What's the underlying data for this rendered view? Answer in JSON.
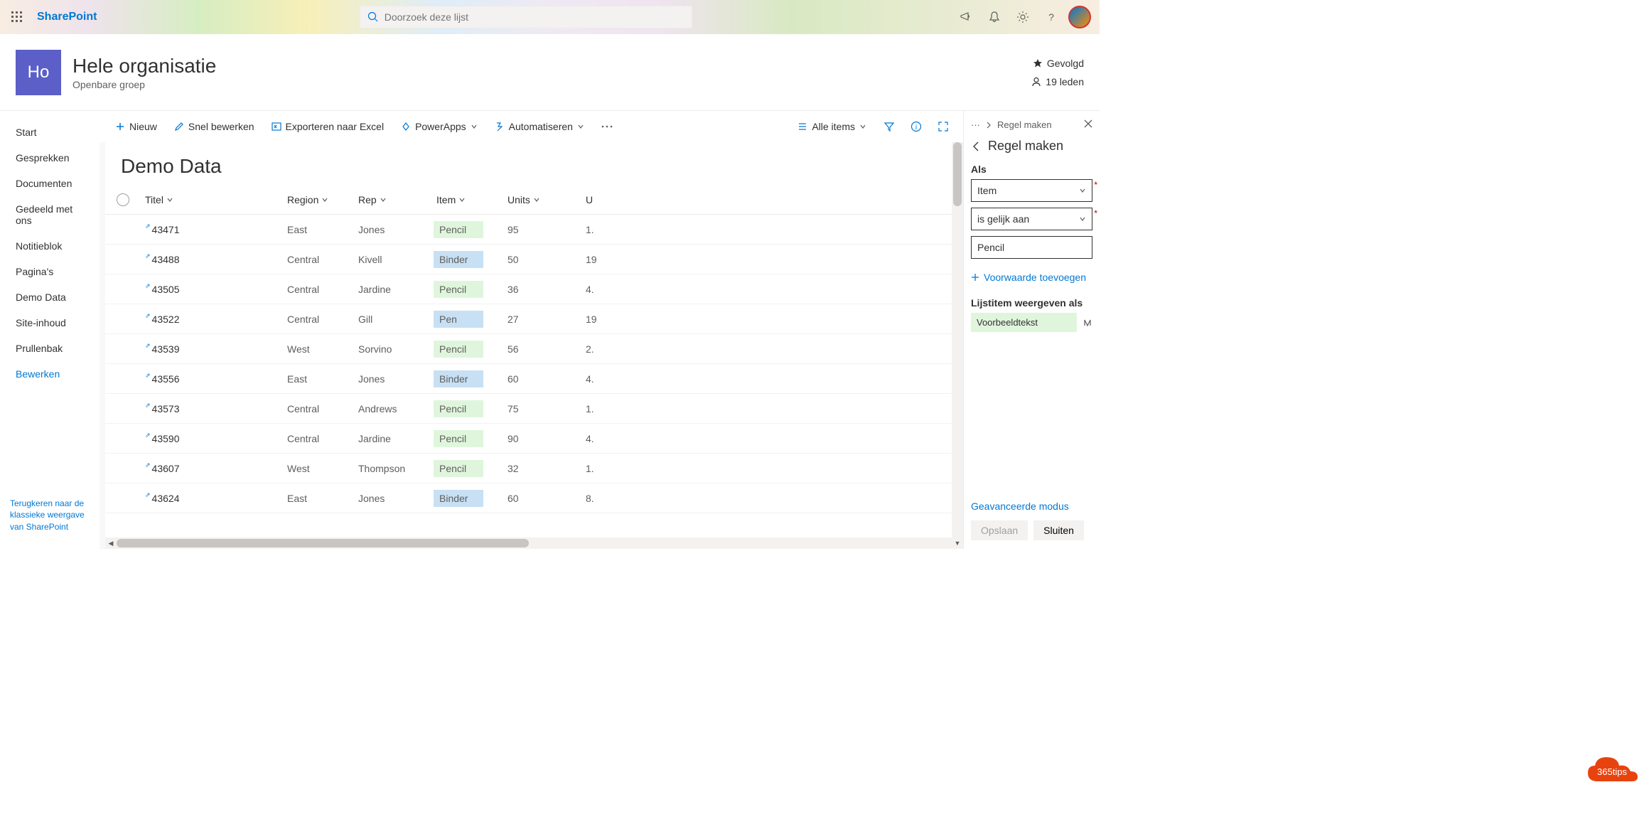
{
  "suite": {
    "brand": "SharePoint",
    "search_placeholder": "Doorzoek deze lijst"
  },
  "site": {
    "logo": "Ho",
    "title": "Hele organisatie",
    "subtitle": "Openbare groep",
    "follow": "Gevolgd",
    "members": "19 leden"
  },
  "nav": {
    "items": [
      "Start",
      "Gesprekken",
      "Documenten",
      "Gedeeld met ons",
      "Notitieblok",
      "Pagina's",
      "Demo Data",
      "Site-inhoud",
      "Prullenbak"
    ],
    "edit": "Bewerken",
    "footer": "Terugkeren naar de klassieke weergave van SharePoint"
  },
  "cmd": {
    "new": "Nieuw",
    "quick": "Snel bewerken",
    "export": "Exporteren naar Excel",
    "powerapps": "PowerApps",
    "automate": "Automatiseren",
    "view": "Alle items"
  },
  "list": {
    "title": "Demo Data",
    "cols": [
      "Titel",
      "Region",
      "Rep",
      "Item",
      "Units",
      "U"
    ],
    "rows": [
      {
        "titel": "43471",
        "region": "East",
        "rep": "Jones",
        "item": "Pencil",
        "item_c": "g",
        "units": "95",
        "u": "1."
      },
      {
        "titel": "43488",
        "region": "Central",
        "rep": "Kivell",
        "item": "Binder",
        "item_c": "b",
        "units": "50",
        "u": "19"
      },
      {
        "titel": "43505",
        "region": "Central",
        "rep": "Jardine",
        "item": "Pencil",
        "item_c": "g",
        "units": "36",
        "u": "4."
      },
      {
        "titel": "43522",
        "region": "Central",
        "rep": "Gill",
        "item": "Pen",
        "item_c": "b",
        "units": "27",
        "u": "19"
      },
      {
        "titel": "43539",
        "region": "West",
        "rep": "Sorvino",
        "item": "Pencil",
        "item_c": "g",
        "units": "56",
        "u": "2."
      },
      {
        "titel": "43556",
        "region": "East",
        "rep": "Jones",
        "item": "Binder",
        "item_c": "b",
        "units": "60",
        "u": "4."
      },
      {
        "titel": "43573",
        "region": "Central",
        "rep": "Andrews",
        "item": "Pencil",
        "item_c": "g",
        "units": "75",
        "u": "1."
      },
      {
        "titel": "43590",
        "region": "Central",
        "rep": "Jardine",
        "item": "Pencil",
        "item_c": "g",
        "units": "90",
        "u": "4."
      },
      {
        "titel": "43607",
        "region": "West",
        "rep": "Thompson",
        "item": "Pencil",
        "item_c": "g",
        "units": "32",
        "u": "1."
      },
      {
        "titel": "43624",
        "region": "East",
        "rep": "Jones",
        "item": "Binder",
        "item_c": "b",
        "units": "60",
        "u": "8."
      }
    ]
  },
  "panel": {
    "crumb": "Regel maken",
    "title": "Regel maken",
    "if_label": "Als",
    "sel_column": "Item",
    "sel_op": "is gelijk aan",
    "sel_value": "Pencil",
    "add_cond": "Voorwaarde toevoegen",
    "show_label": "Lijstitem weergeven als",
    "preview": "Voorbeeldtekst",
    "adv": "Geavanceerde modus",
    "save": "Opslaan",
    "close": "Sluiten"
  },
  "badge": "365tips"
}
